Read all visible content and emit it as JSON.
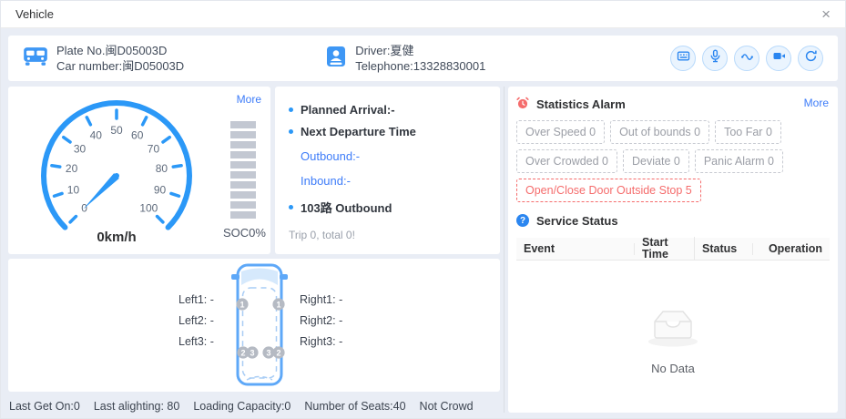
{
  "dialog": {
    "title": "Vehicle",
    "close_icon": "×"
  },
  "header": {
    "plate_no": "Plate No.闽D05003D",
    "car_number": "Car number:闽D05003D",
    "driver": "Driver:夏健",
    "telephone": "Telephone:13328830001",
    "actions": [
      {
        "icon": "led-screen-icon"
      },
      {
        "icon": "microphone-icon"
      },
      {
        "icon": "track-icon"
      },
      {
        "icon": "video-camera-icon"
      },
      {
        "icon": "refresh-icon"
      }
    ]
  },
  "gauge_panel": {
    "more_label": "More",
    "speed_text": "0km/h",
    "soc_label": "SOC0%",
    "soc_bar_count": 10,
    "chart_data": {
      "type": "gauge",
      "title": "Speed",
      "min": 0,
      "max": 100,
      "step": 10,
      "tick_labels": [
        0,
        10,
        20,
        30,
        40,
        50,
        60,
        70,
        80,
        90,
        100
      ],
      "value": 0,
      "unit": "km/h"
    }
  },
  "schedule_panel": {
    "planned_arrival": "Planned Arrival:-",
    "next_departure_title": "Next Departure Time",
    "outbound": "Outbound:-",
    "inbound": "Inbound:-",
    "route": "103路 Outbound",
    "trip_info": "Trip 0, total 0!"
  },
  "door_panel": {
    "left_labels": [
      "Left1: -",
      "Left2: -",
      "Left3: -"
    ],
    "right_labels": [
      "Right1: -",
      "Right2: -",
      "Right3: -"
    ],
    "badge_numbers": [
      "1",
      "1",
      "2",
      "3",
      "3",
      "2"
    ]
  },
  "bottom_stats": {
    "items": [
      "Last Get On:0",
      "Last alighting: 80",
      "Loading Capacity:0",
      "Number of Seats:40",
      "Not Crowd"
    ]
  },
  "statistics_alarm": {
    "title": "Statistics Alarm",
    "more_label": "More",
    "alarms": [
      {
        "label": "Over Speed 0",
        "danger": false
      },
      {
        "label": "Out of bounds 0",
        "danger": false
      },
      {
        "label": "Too Far 0",
        "danger": false
      },
      {
        "label": "Over Crowded 0",
        "danger": false
      },
      {
        "label": "Deviate 0",
        "danger": false
      },
      {
        "label": "Panic Alarm 0",
        "danger": false
      },
      {
        "label": "Open/Close Door Outside Stop 5",
        "danger": true
      }
    ]
  },
  "service_status": {
    "title": "Service Status",
    "columns": [
      "Event",
      "Start Time",
      "Status",
      "Operation"
    ],
    "rows": [],
    "empty_text": "No Data"
  },
  "colors": {
    "primary": "#2b98f7",
    "link": "#3d7cf9",
    "danger": "#f56c6c",
    "page_bg": "#e9edf5"
  }
}
